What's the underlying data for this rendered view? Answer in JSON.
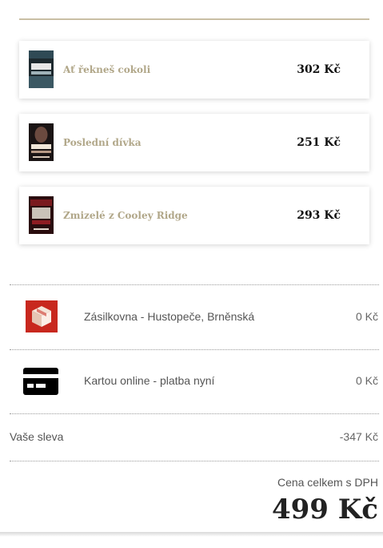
{
  "cart": {
    "items": [
      {
        "title": "Ať řekneš cokoli",
        "price": "302 Kč",
        "cover_color": "#1e2a2f"
      },
      {
        "title": "Poslední dívka",
        "price": "251 Kč",
        "cover_color": "#2a1c1a"
      },
      {
        "title": "Zmizelé z Cooley Ridge",
        "price": "293 Kč",
        "cover_color": "#3a0f12"
      }
    ]
  },
  "shipping": {
    "label": "Zásilkovna - Hustopeče, Brněnská",
    "price": "0 Kč",
    "icon": "package-icon",
    "icon_color": "#c8281e"
  },
  "payment": {
    "label": "Kartou online - platba nyní",
    "price": "0 Kč",
    "icon": "credit-card-icon"
  },
  "discount": {
    "label": "Vaše sleva",
    "value": "-347 Kč"
  },
  "total": {
    "label": "Cena celkem s DPH",
    "value": "499 Kč"
  },
  "colors": {
    "accent": "#b1a789",
    "rule": "#c9bfa4"
  }
}
